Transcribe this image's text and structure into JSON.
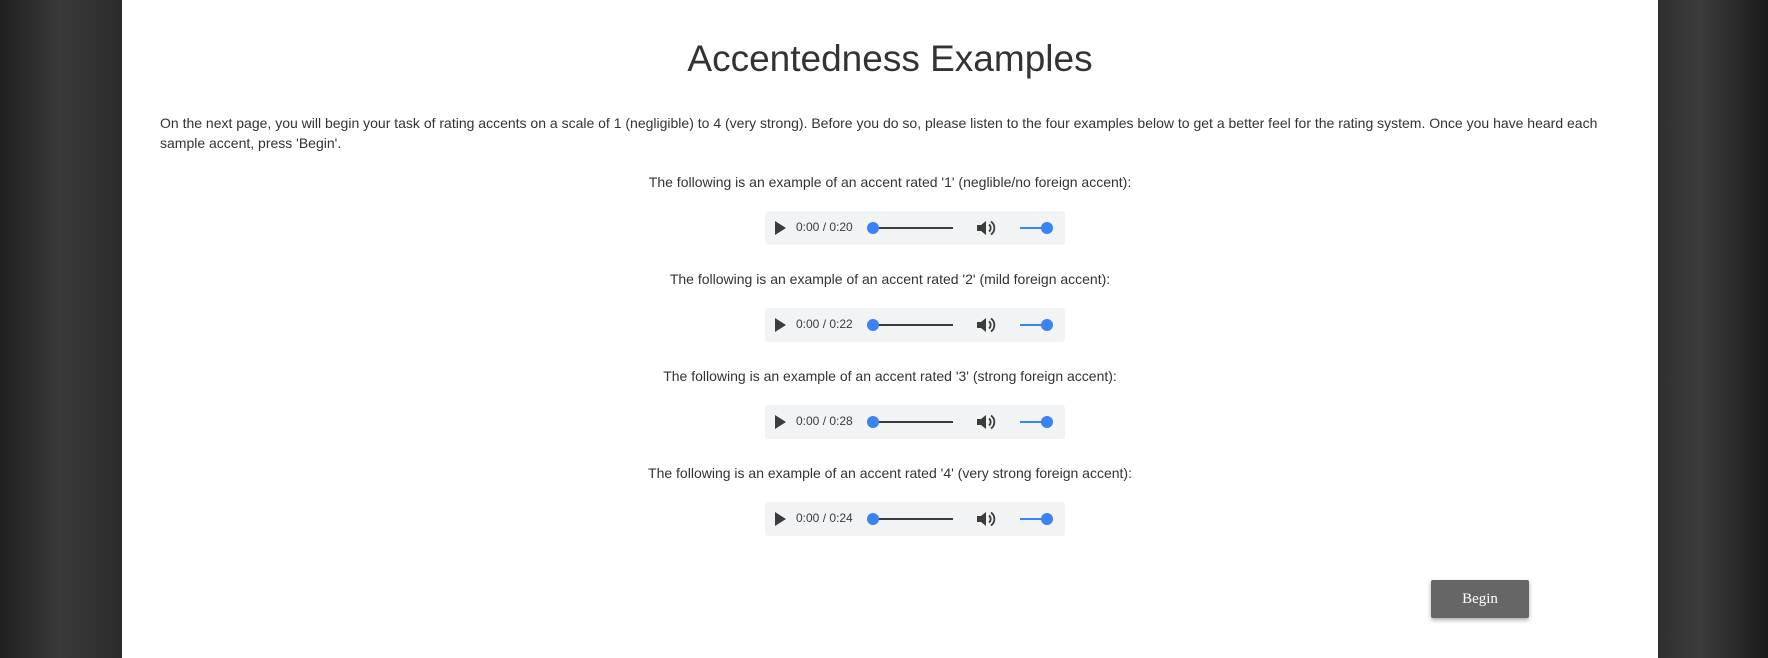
{
  "page": {
    "title": "Accentedness Examples",
    "intro": "On the next page, you will begin your task of rating accents on a scale of 1 (negligible) to 4 (very strong). Before you do so, please listen to the four examples below to get a better feel for the rating system. Once you have heard each sample accent, press 'Begin'."
  },
  "examples": [
    {
      "label": "The following is an example of an accent rated '1' (neglible/no foreign accent):",
      "time": "0:00 / 0:20"
    },
    {
      "label": "The following is an example of an accent rated '2' (mild foreign accent):",
      "time": "0:00 / 0:22"
    },
    {
      "label": "The following is an example of an accent rated '3' (strong foreign accent):",
      "time": "0:00 / 0:28"
    },
    {
      "label": "The following is an example of an accent rated '4' (very strong foreign accent):",
      "time": "0:00 / 0:24"
    }
  ],
  "player": {
    "progress_fraction": 0,
    "volume_fraction": 1,
    "accent_color": "#3b82f6",
    "icons": {
      "play": "play-icon",
      "volume": "volume-icon"
    }
  },
  "actions": {
    "begin_label": "Begin"
  }
}
